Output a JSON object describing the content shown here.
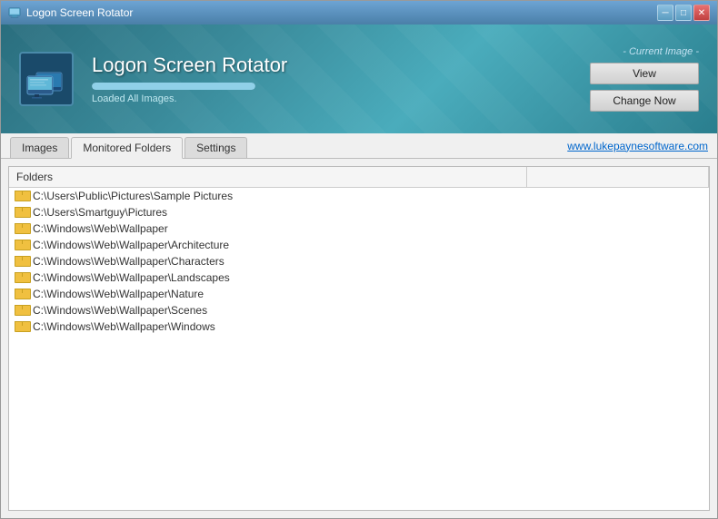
{
  "window": {
    "title": "Logon Screen Rotator",
    "titlebar": {
      "minimize_label": "─",
      "maximize_label": "□",
      "close_label": "✕"
    }
  },
  "header": {
    "app_title": "Logon Screen Rotator",
    "status": "Loaded All Images.",
    "current_image_label": "- Current Image -",
    "view_button": "View",
    "change_now_button": "Change Now",
    "progress_pct": 100
  },
  "tabs": [
    {
      "id": "images",
      "label": "Images",
      "active": false
    },
    {
      "id": "monitored-folders",
      "label": "Monitored Folders",
      "active": true
    },
    {
      "id": "settings",
      "label": "Settings",
      "active": false
    }
  ],
  "link": {
    "url_text": "www.lukepaynesoftware.com"
  },
  "folders_table": {
    "column_header": "Folders",
    "column_secondary": "",
    "items": [
      {
        "path": "C:\\Users\\Public\\Pictures\\Sample Pictures"
      },
      {
        "path": "C:\\Users\\Smartguy\\Pictures"
      },
      {
        "path": "C:\\Windows\\Web\\Wallpaper"
      },
      {
        "path": "C:\\Windows\\Web\\Wallpaper\\Architecture"
      },
      {
        "path": "C:\\Windows\\Web\\Wallpaper\\Characters"
      },
      {
        "path": "C:\\Windows\\Web\\Wallpaper\\Landscapes"
      },
      {
        "path": "C:\\Windows\\Web\\Wallpaper\\Nature"
      },
      {
        "path": "C:\\Windows\\Web\\Wallpaper\\Scenes"
      },
      {
        "path": "C:\\Windows\\Web\\Wallpaper\\Windows"
      }
    ]
  }
}
